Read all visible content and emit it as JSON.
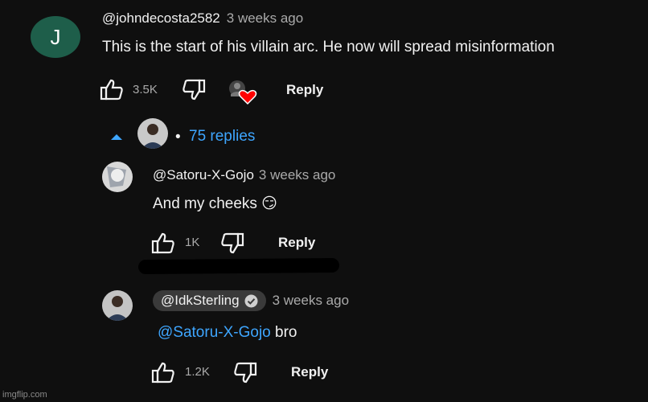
{
  "comment": {
    "avatar_letter": "J",
    "handle": "@johndecosta2582",
    "time": "3 weeks ago",
    "text": "This is the start of his villain arc. He now will spread misinformation",
    "likes": "3.5K",
    "reply_label": "Reply"
  },
  "replies_toggle": {
    "dot": "•",
    "label": "75 replies"
  },
  "replies": [
    {
      "handle": "@Satoru-X-Gojo",
      "time": "3 weeks ago",
      "text": "And my cheeks 😏",
      "likes": "1K",
      "reply_label": "Reply"
    },
    {
      "handle": "@IdkSterling",
      "time": "3 weeks ago",
      "mention": "@Satoru-X-Gojo",
      "text": " bro",
      "likes": "1.2K",
      "reply_label": "Reply"
    }
  ],
  "watermark": "imgflip.com",
  "colors": {
    "background": "#0f0f0f",
    "link": "#3ea6ff",
    "avatar_j": "#1e5e4a",
    "heart": "#ff0000"
  }
}
